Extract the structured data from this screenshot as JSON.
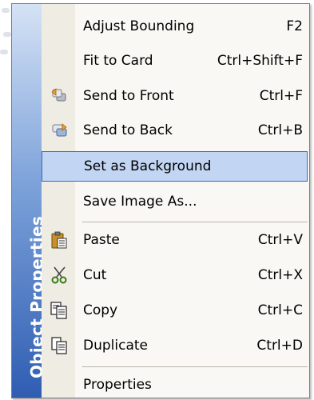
{
  "menu": {
    "side_title": "Object Properties",
    "items": [
      {
        "label": "Adjust Bounding",
        "shortcut": "F2",
        "icon": "none"
      },
      {
        "label": "Fit to Card",
        "shortcut": "Ctrl+Shift+F",
        "icon": "none"
      },
      {
        "label": "Send to Front",
        "shortcut": "Ctrl+F",
        "icon": "send-to-front-icon"
      },
      {
        "label": "Send to Back",
        "shortcut": "Ctrl+B",
        "icon": "send-to-back-icon"
      },
      {
        "label": "Set as Background",
        "shortcut": "",
        "icon": "none",
        "state": "highlighted"
      },
      {
        "label": "Save Image As...",
        "shortcut": "",
        "icon": "none"
      },
      {
        "label": "Paste",
        "shortcut": "Ctrl+V",
        "icon": "paste-icon"
      },
      {
        "label": "Cut",
        "shortcut": "Ctrl+X",
        "icon": "cut-icon"
      },
      {
        "label": "Copy",
        "shortcut": "Ctrl+C",
        "icon": "copy-icon"
      },
      {
        "label": "Duplicate",
        "shortcut": "Ctrl+D",
        "icon": "duplicate-icon"
      },
      {
        "label": "Properties",
        "shortcut": "",
        "icon": "none"
      }
    ]
  },
  "colors": {
    "highlight_fill": "#c2d5f2",
    "highlight_border": "#3b67bf",
    "side_band_dark": "#2f5db2",
    "side_band_light": "#d5e2f5"
  }
}
